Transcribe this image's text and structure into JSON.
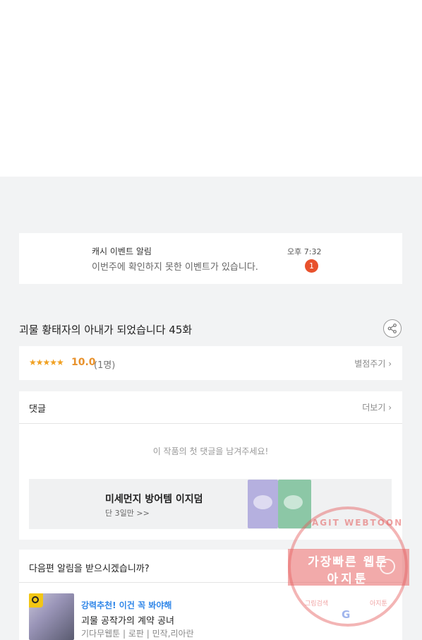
{
  "notification": {
    "title": "캐시 이벤트 알림",
    "message": "이번주에 확인하지 못한 이벤트가 있습니다.",
    "time": "오후 7:32",
    "badge": "1"
  },
  "episode": {
    "title": "괴물 황태자의 아내가 되었습니다 45화"
  },
  "rating": {
    "stars": "★★★★★",
    "score": "10.0",
    "count": "(1명)",
    "rate_label": "별점주기 ›"
  },
  "comments": {
    "header": "댓글",
    "more": "더보기 ›",
    "empty": "이 작품의 첫 댓글을 남겨주세요!"
  },
  "ad": {
    "title": "미세먼지 방어템 이지덤",
    "subtitle": "단 3일만 >>"
  },
  "next_alert": {
    "question": "다음편 알림을 받으시겠습니까?",
    "recommend": "강력추천! 이건 꼭 봐야해",
    "webtoon_title": "괴물 공작가의 계약 공녀",
    "meta": "기다무웹툰 | 로판 | 민작,리아란"
  },
  "watermark": {
    "arc_text": "AGIT WEBTOON",
    "line1": "가장빠른 웹툰",
    "line2": "아지툰",
    "bottom_left": "그림검색",
    "bottom_right": "아지툰",
    "logo": "G"
  }
}
